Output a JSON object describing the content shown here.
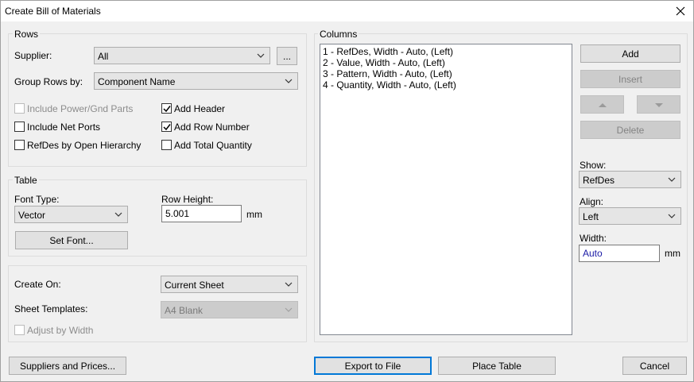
{
  "window": {
    "title": "Create Bill of Materials"
  },
  "rows": {
    "group_label": "Rows",
    "supplier_label": "Supplier:",
    "supplier_value": "All",
    "supplier_browse_label": "...",
    "group_rows_label": "Group Rows by:",
    "group_rows_value": "Component Name",
    "options": [
      {
        "label": "Include Power/Gnd Parts",
        "checked": false,
        "disabled": true
      },
      {
        "label": "Include Net Ports",
        "checked": false,
        "disabled": false
      },
      {
        "label": "RefDes by Open Hierarchy",
        "checked": false,
        "disabled": false
      },
      {
        "label": "Add Header",
        "checked": true,
        "disabled": false
      },
      {
        "label": "Add Row Number",
        "checked": true,
        "disabled": false
      },
      {
        "label": "Add Total Quantity",
        "checked": false,
        "disabled": false
      }
    ]
  },
  "table": {
    "group_label": "Table",
    "font_type_label": "Font Type:",
    "font_type_value": "Vector",
    "row_height_label": "Row Height:",
    "row_height_value": "5.001",
    "row_height_unit": "mm",
    "set_font_label": "Set Font..."
  },
  "create": {
    "create_on_label": "Create On:",
    "create_on_value": "Current Sheet",
    "sheet_templates_label": "Sheet Templates:",
    "sheet_templates_value": "A4 Blank",
    "adjust_label": "Adjust by Width"
  },
  "columns": {
    "group_label": "Columns",
    "items": [
      "1 - RefDes, Width - Auto, (Left)",
      "2 - Value, Width - Auto, (Left)",
      "3 - Pattern, Width - Auto, (Left)",
      "4 - Quantity, Width - Auto, (Left)"
    ],
    "add_label": "Add",
    "insert_label": "Insert",
    "delete_label": "Delete",
    "show_label": "Show:",
    "show_value": "RefDes",
    "align_label": "Align:",
    "align_value": "Left",
    "width_label": "Width:",
    "width_value": "Auto",
    "width_unit": "mm"
  },
  "footer": {
    "suppliers_label": "Suppliers and Prices...",
    "export_label": "Export to File",
    "place_label": "Place Table",
    "cancel_label": "Cancel"
  }
}
